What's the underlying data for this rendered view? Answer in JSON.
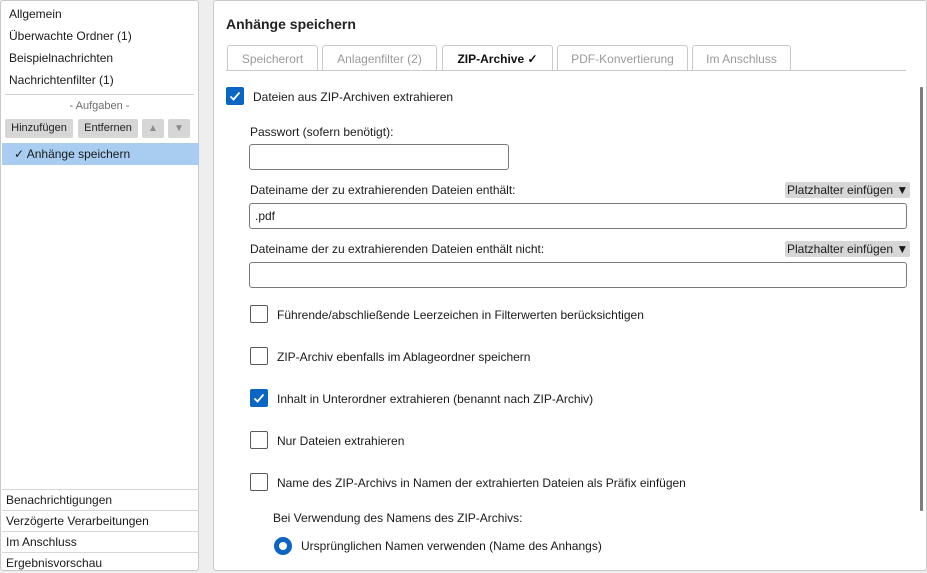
{
  "left": {
    "nav": [
      "Allgemein",
      "Überwachte Ordner (1)",
      "Beispielnachrichten",
      "Nachrichtenfilter (1)"
    ],
    "tasks_header": "- Aufgaben -",
    "buttons": {
      "add": "Hinzufügen",
      "remove": "Entfernen",
      "up": "▲",
      "down": "▼"
    },
    "selected_task": "✓ Anhänge speichern",
    "bottom": [
      "Benachrichtigungen",
      "Verzögerte Verarbeitungen",
      "Im Anschluss",
      "Ergebnisvorschau"
    ]
  },
  "main": {
    "title": "Anhänge speichern",
    "tabs": [
      "Speicherort",
      "Anlagenfilter (2)",
      "ZIP-Archive ✓",
      "PDF-Konvertierung",
      "Im Anschluss"
    ],
    "active_tab": "ZIP-Archive ✓",
    "extract_checkbox": {
      "label": "Dateien aus ZIP-Archiven extrahieren",
      "checked": true
    },
    "password": {
      "label": "Passwort (sofern benötigt):",
      "value": ""
    },
    "include": {
      "label": "Dateiname der zu extrahierenden Dateien enthält:",
      "value": ".pdf",
      "placeholder_btn": "Platzhalter einfügen ▼"
    },
    "exclude": {
      "label": "Dateiname der zu extrahierenden Dateien enthält nicht:",
      "value": "",
      "placeholder_btn": "Platzhalter einfügen ▼"
    },
    "options": [
      {
        "label": "Führende/abschließende Leerzeichen in Filterwerten berücksichtigen",
        "checked": false
      },
      {
        "label": "ZIP-Archiv ebenfalls im Ablageordner speichern",
        "checked": false
      },
      {
        "label": "Inhalt in Unterordner extrahieren (benannt nach ZIP-Archiv)",
        "checked": true
      },
      {
        "label": "Nur Dateien extrahieren",
        "checked": false
      },
      {
        "label": "Name des ZIP-Archivs in Namen der extrahierten Dateien als Präfix einfügen",
        "checked": false
      }
    ],
    "name_usage_label": "Bei Verwendung des Namens des ZIP-Archivs:",
    "radio_option": {
      "label": "Ursprünglichen Namen verwenden (Name des Anhangs)",
      "selected": true
    }
  },
  "colors": {
    "accent": "#0a66c2",
    "selection": "#a8cdf0"
  }
}
